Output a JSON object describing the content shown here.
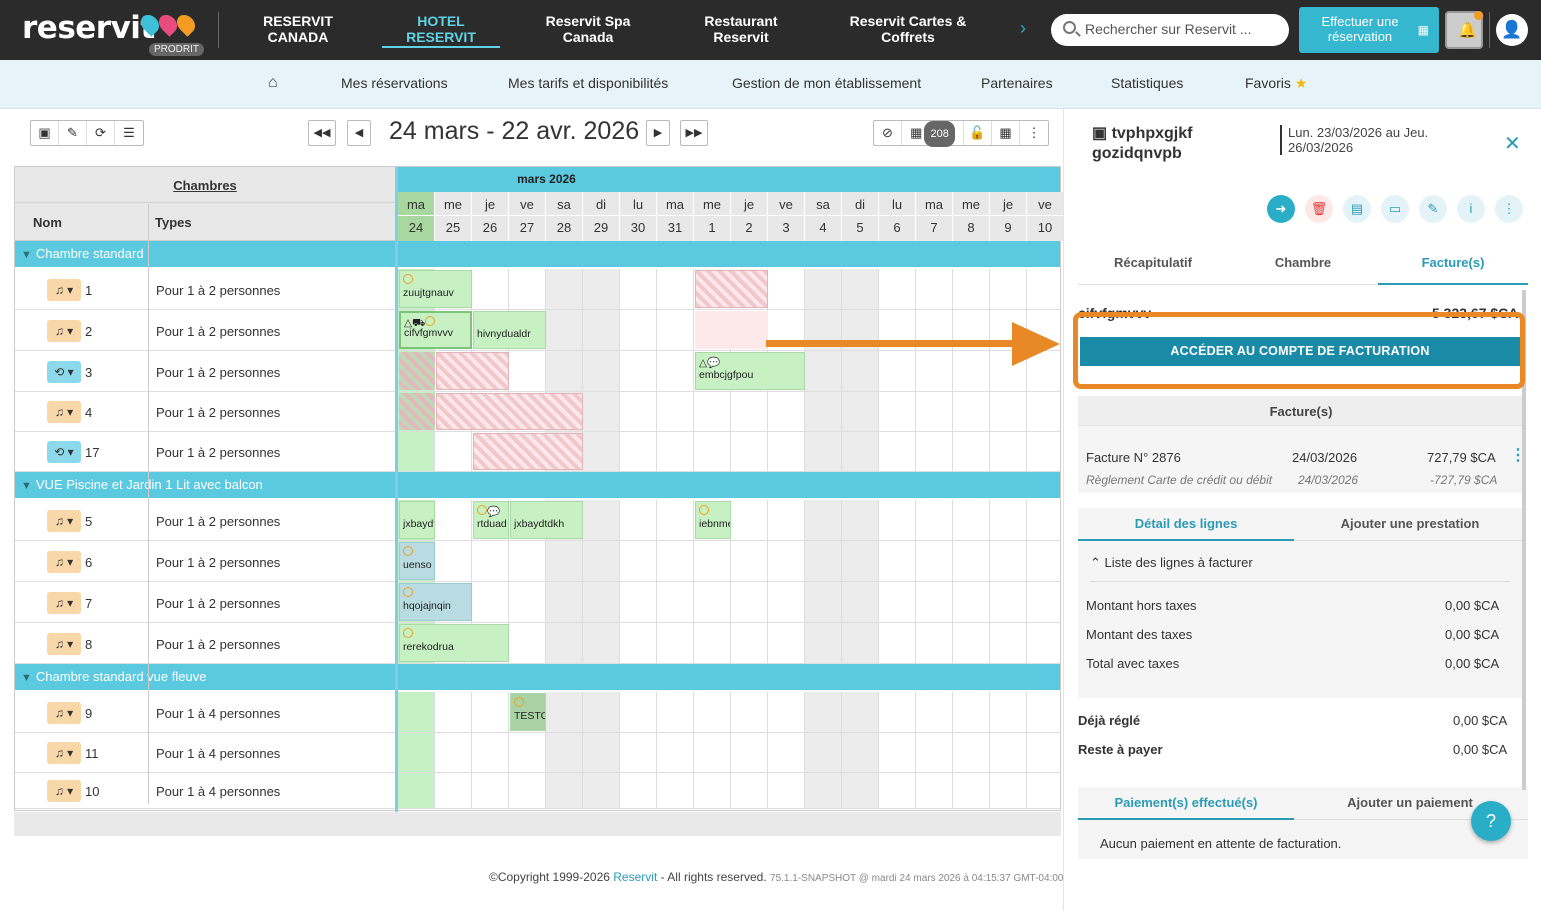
{
  "brand": {
    "logo": "reservit",
    "badge": "PRODRIT"
  },
  "topnav": [
    {
      "label": "RESERVIT\nCANADA"
    },
    {
      "label": "HOTEL\nRESERVIT",
      "active": true
    },
    {
      "label": "Reservit Spa\nCanada"
    },
    {
      "label": "Restaurant\nReservit"
    },
    {
      "label": "Reservit Cartes &\nCoffrets"
    }
  ],
  "search": {
    "placeholder": "Rechercher sur Reservit ..."
  },
  "book_button": "Effectuer une réservation",
  "subnav": [
    "Mes réservations",
    "Mes tarifs et disponibilités",
    "Gestion de mon établissement",
    "Partenaires",
    "Statistiques",
    "Favoris"
  ],
  "planning": {
    "date_range": "24 mars - 22 avr. 2026",
    "count": "208",
    "header": {
      "rooms": "Chambres",
      "name": "Nom",
      "types": "Types"
    },
    "month": "mars 2026",
    "days": [
      {
        "w": "ma",
        "d": "24"
      },
      {
        "w": "me",
        "d": "25"
      },
      {
        "w": "je",
        "d": "26"
      },
      {
        "w": "ve",
        "d": "27"
      },
      {
        "w": "sa",
        "d": "28"
      },
      {
        "w": "di",
        "d": "29"
      },
      {
        "w": "lu",
        "d": "30"
      },
      {
        "w": "ma",
        "d": "31"
      },
      {
        "w": "me",
        "d": "1"
      },
      {
        "w": "je",
        "d": "2"
      },
      {
        "w": "ve",
        "d": "3"
      },
      {
        "w": "sa",
        "d": "4"
      },
      {
        "w": "di",
        "d": "5"
      },
      {
        "w": "lu",
        "d": "6"
      },
      {
        "w": "ma",
        "d": "7"
      },
      {
        "w": "me",
        "d": "8"
      },
      {
        "w": "je",
        "d": "9"
      },
      {
        "w": "ve",
        "d": "10"
      }
    ],
    "groups": [
      {
        "name": "Chambre standard",
        "rooms": [
          {
            "num": "1",
            "type": "Pour 1 à 2 personnes",
            "icon": "orange"
          },
          {
            "num": "2",
            "type": "Pour 1 à 2 personnes",
            "icon": "orange"
          },
          {
            "num": "3",
            "type": "Pour 1 à 2 personnes",
            "icon": "blue"
          },
          {
            "num": "4",
            "type": "Pour 1 à 2 personnes",
            "icon": "orange"
          },
          {
            "num": "17",
            "type": "Pour 1 à 2 personnes",
            "icon": "blue"
          }
        ]
      },
      {
        "name": "VUE Piscine et Jardin 1 Lit avec balcon",
        "rooms": [
          {
            "num": "5",
            "type": "Pour 1 à 2 personnes",
            "icon": "orange"
          },
          {
            "num": "6",
            "type": "Pour 1 à 2 personnes",
            "icon": "orange"
          },
          {
            "num": "7",
            "type": "Pour 1 à 2 personnes",
            "icon": "orange"
          },
          {
            "num": "8",
            "type": "Pour 1 à 2 personnes",
            "icon": "orange"
          }
        ]
      },
      {
        "name": "Chambre standard vue fleuve",
        "rooms": [
          {
            "num": "9",
            "type": "Pour 1 à 4 personnes",
            "icon": "orange"
          },
          {
            "num": "11",
            "type": "Pour 1 à 4 personnes",
            "icon": "orange"
          },
          {
            "num": "10",
            "type": "Pour 1 à 4 personnes",
            "icon": "orange"
          }
        ]
      }
    ],
    "reservations": {
      "r1": "zuujtgnauv",
      "r2a": "cifvfgmvvv",
      "r2b": "hivnydualdr",
      "r3": "embcjgfpou",
      "r5a": "jxbaydt",
      "r5b": "rtduad",
      "r5c": "jxbaydtdkh",
      "r5d": "iebnme",
      "r6": "uenso",
      "r7": "hqojajnqin",
      "r8": "rerekodrua",
      "r9": "TESTO"
    }
  },
  "footer": {
    "copyright": "©Copyright 1999-2026",
    "brand": "Reservit",
    "rights": "- All rights reserved.",
    "version": "75.1.1-SNAPSHOT @ mardi 24 mars 2026 à 04:15:37 GMT-04:00"
  },
  "panel": {
    "title": "tvphpxgjkf gozidqnvpb",
    "dates": "Lun. 23/03/2026 au Jeu. 26/03/2026",
    "tabs": [
      "Récapitulatif",
      "Chambre",
      "Facture(s)"
    ],
    "partial_name": "cifvfgmvvv",
    "partial_amount": "5 323,67 $CA",
    "account_button": "ACCÉDER AU COMPTE DE FACTURATION",
    "invoices_title": "Facture(s)",
    "invoice": {
      "label": "Facture N° 2876",
      "date": "24/03/2026",
      "amount": "727,79 $CA",
      "payment": "Règlement Carte de crédit ou débit",
      "payment_date": "24/03/2026",
      "payment_amount": "-727,79 $CA"
    },
    "detail_tabs": [
      "Détail des lignes",
      "Ajouter une prestation"
    ],
    "lines_title": "Liste des lignes à facturer",
    "amounts": [
      {
        "label": "Montant hors taxes",
        "value": "0,00 $CA"
      },
      {
        "label": "Montant des taxes",
        "value": "0,00 $CA"
      },
      {
        "label": "Total avec taxes",
        "value": "0,00 $CA"
      }
    ],
    "paid": {
      "label": "Déjà réglé",
      "value": "0,00 $CA"
    },
    "remaining": {
      "label": "Reste à payer",
      "value": "0,00 $CA"
    },
    "payment_tabs": [
      "Paiement(s) effectué(s)",
      "Ajouter un paiement"
    ],
    "no_payment": "Aucun paiement en attente de facturation."
  },
  "colors": {
    "accent": "#2a9bb5",
    "header": "#2b2b2b",
    "highlight": "#e88826",
    "group": "#5bc9df"
  }
}
